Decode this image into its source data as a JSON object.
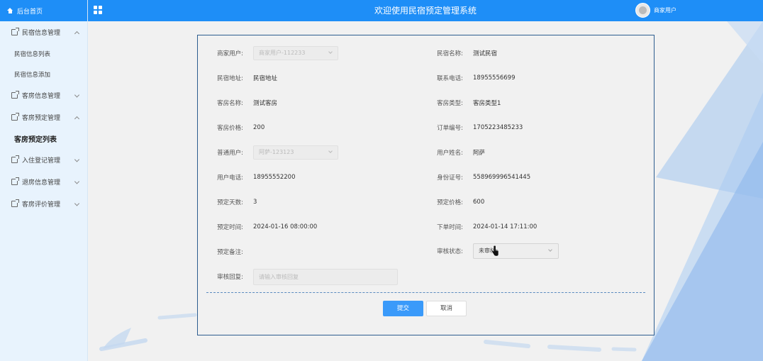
{
  "sidebar": {
    "home": "后台首页",
    "groups": [
      {
        "label": "民宿信息管理",
        "items": [
          "民宿信息列表",
          "民宿信息添加"
        ]
      },
      {
        "label": "客房信息管理"
      },
      {
        "label": "客房预定管理",
        "items": [
          "客房预定列表"
        ]
      },
      {
        "label": "入住登记管理"
      },
      {
        "label": "退房信息管理"
      },
      {
        "label": "客房评价管理"
      }
    ]
  },
  "header": {
    "title": "欢迎使用民宿预定管理系统",
    "user": "商家用户"
  },
  "form": {
    "merchant_label": "商家用户:",
    "merchant_value": "商家用户-112233",
    "homestay_name_label": "民宿名称:",
    "homestay_name_value": "测试民宿",
    "address_label": "民宿地址:",
    "address_value": "民宿地址",
    "phone_label": "联系电话:",
    "phone_value": "18955556699",
    "room_name_label": "客房名称:",
    "room_name_value": "测试客房",
    "room_type_label": "客房类型:",
    "room_type_value": "客房类型1",
    "room_price_label": "客房价格:",
    "room_price_value": "200",
    "order_no_label": "订单编号:",
    "order_no_value": "1705223485233",
    "user_label": "普通用户:",
    "user_value": "阿萨-123123",
    "user_name_label": "用户姓名:",
    "user_name_value": "阿萨",
    "user_phone_label": "用户电话:",
    "user_phone_value": "18955552200",
    "id_card_label": "身份证号:",
    "id_card_value": "558969996541445",
    "days_label": "预定天数:",
    "days_value": "3",
    "total_price_label": "预定价格:",
    "total_price_value": "600",
    "book_time_label": "预定时间:",
    "book_time_value": "2024-01-16 08:00:00",
    "order_time_label": "下单时间:",
    "order_time_value": "2024-01-14 17:11:00",
    "remark_label": "预定备注:",
    "review_status_label": "审核状态:",
    "review_status_value": "未审核",
    "review_reply_label": "审核回复:",
    "review_reply_placeholder": "请输入审核回复",
    "submit": "提交",
    "cancel": "取消"
  }
}
